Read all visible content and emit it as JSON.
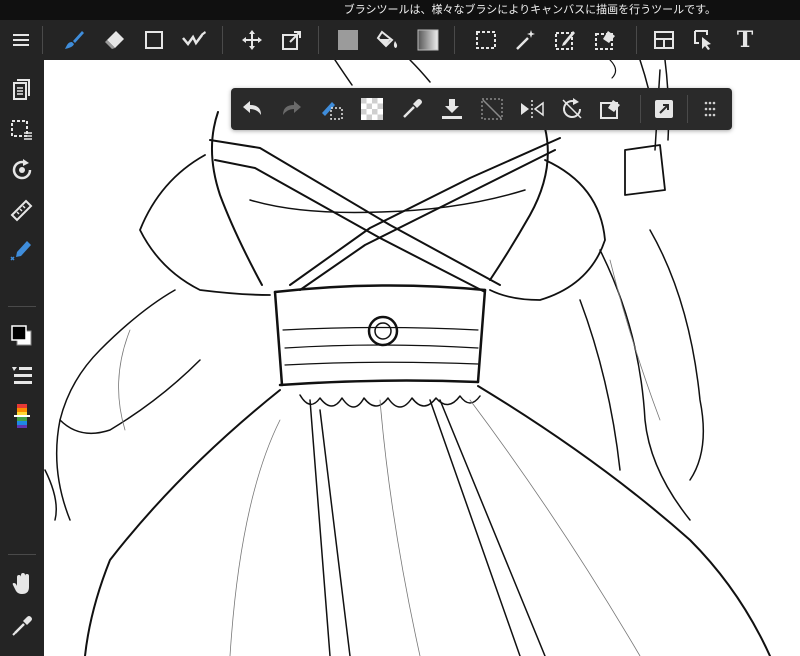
{
  "status_bar": {
    "tooltip": "ブラシツールは、様々なブラシによりキャンバスに描画を行うツールです。"
  },
  "toolbar": {
    "items": [
      "menu-icon",
      "brush-tool-icon",
      "eraser-tool-icon",
      "shape-tool-icon",
      "correction-tool-icon",
      "move-tool-icon",
      "transform-tool-icon",
      "fill-tool-icon",
      "bucket-tool-icon",
      "gradient-tool-icon",
      "select-tool-icon",
      "magic-wand-tool-icon",
      "select-pen-tool-icon",
      "select-eraser-tool-icon",
      "frame-divider-tool-icon",
      "operation-tool-icon",
      "text-tool-icon"
    ],
    "text_tool_glyph": "T"
  },
  "sidebar": {
    "items": [
      "layers-icon",
      "selection-layer-icon",
      "rotate-canvas-icon",
      "ruler-icon",
      "pen-settings-icon",
      "color-swatch-icon",
      "brush-list-icon",
      "color-palette-icon",
      "hand-tool-icon",
      "eyedropper-tool-icon"
    ]
  },
  "selection_toolbar": {
    "items": [
      "undo-icon",
      "redo-icon",
      "deselect-icon",
      "invert-selection-icon",
      "selection-color-icon",
      "download-icon",
      "clear-icon",
      "flip-horizontal-icon",
      "rotate-icon",
      "transform-selection-icon",
      "expand-icon",
      "grip-icon"
    ]
  },
  "colors": {
    "toolbar_bg": "#242424",
    "tipbar_bg": "#101010",
    "accent_blue": "#3f8ddb",
    "icon": "#e6e6e6",
    "icon_dim": "#6a6a6a",
    "canvas": "#ffffff"
  }
}
